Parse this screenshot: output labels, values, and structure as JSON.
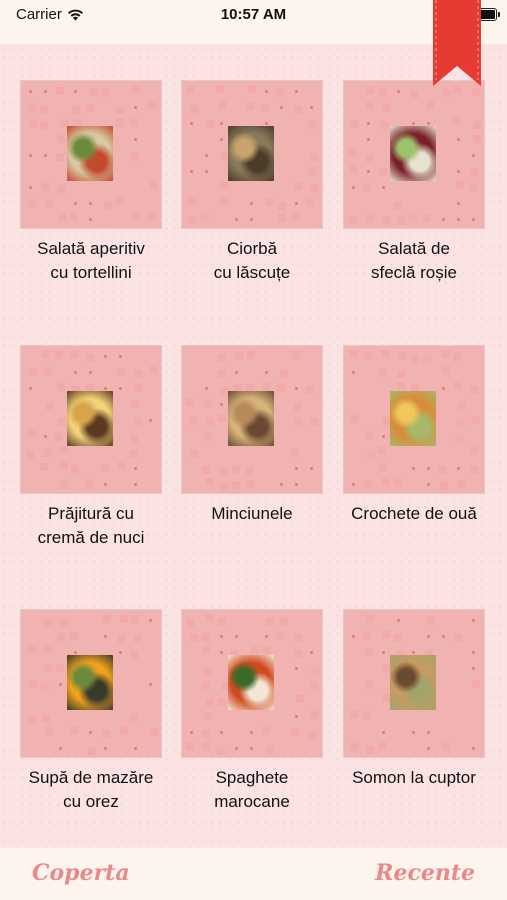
{
  "status": {
    "carrier": "Carrier",
    "time": "10:57 AM"
  },
  "recipes": [
    {
      "title": "Salată aperitiv\ncu tortellini",
      "photo_colors": [
        "#d8c9a2",
        "#6b8b3a",
        "#c44a2e"
      ]
    },
    {
      "title": "Ciorbă\ncu lăscuțe",
      "photo_colors": [
        "#8b7a5a",
        "#c9a36b",
        "#4b3b2a"
      ]
    },
    {
      "title": "Salată de\nsfeclă roșie",
      "photo_colors": [
        "#7a1f2a",
        "#9cc36b",
        "#e8e3d0"
      ]
    },
    {
      "title": "Prăjitură cu\ncremă de nuci",
      "photo_colors": [
        "#f3d27a",
        "#d7a44a",
        "#5a3a22"
      ]
    },
    {
      "title": "Minciunele",
      "photo_colors": [
        "#d8b47a",
        "#b88a5a",
        "#6a4a32"
      ]
    },
    {
      "title": "Crochete de ouă",
      "photo_colors": [
        "#d98c3a",
        "#f0c75a",
        "#a7b86b"
      ]
    },
    {
      "title": "Supă de mazăre\ncu orez",
      "photo_colors": [
        "#f0a11e",
        "#6b8a3a",
        "#3a3a2a"
      ]
    },
    {
      "title": "Spaghete\nmarocane",
      "photo_colors": [
        "#d04a1f",
        "#3a6a2a",
        "#f2e6d6"
      ]
    },
    {
      "title": "Somon la cuptor",
      "photo_colors": [
        "#c79b62",
        "#6b4a32",
        "#a2a46a"
      ]
    }
  ],
  "tabs": {
    "left": "Coperta",
    "right": "Recente"
  },
  "colors": {
    "accent": "#e98a8a",
    "bookmark": "#e53b32",
    "tile_pattern": "#f1a9a9"
  }
}
